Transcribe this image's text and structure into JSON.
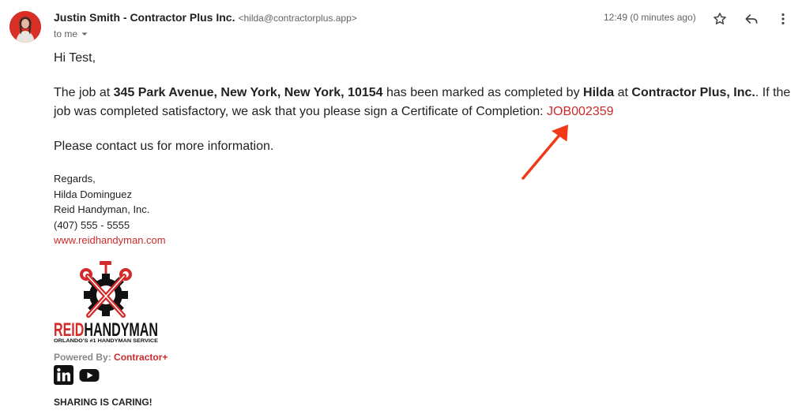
{
  "header": {
    "sender_name": "Justin Smith - Contractor Plus Inc.",
    "sender_email": "<hilda@contractorplus.app>",
    "to_label": "to me",
    "timestamp": "12:49 (0 minutes ago)"
  },
  "body": {
    "greeting": "Hi Test,",
    "p1_a": "The job at ",
    "address": "345 Park Avenue, New York, New York, 10154",
    "p1_b": " has been marked as completed by ",
    "worker": "Hilda",
    "p1_c": " at ",
    "company": "Contractor Plus, Inc.",
    "p1_d": ". If the job was completed satisfactory, we ask that you please sign a Certificate of Completion: ",
    "job_link": "JOB002359",
    "p2": "Please contact us for more information."
  },
  "signature": {
    "regards": "Regards,",
    "name": "Hilda Dominguez",
    "company": "Reid Handyman, Inc.",
    "phone": "(407) 555 - 5555",
    "website": "www.reidhandyman.com"
  },
  "logo": {
    "name_red": "REID",
    "name_black": "HANDYMAN",
    "tagline": "ORLANDO'S #1 HANDYMAN SERVICE"
  },
  "footer": {
    "powered_label": "Powered By: ",
    "powered_brand": "Contractor+",
    "sharing": "SHARING IS CARING!"
  },
  "icons": {
    "star": "star-icon",
    "reply": "reply-icon",
    "more": "more-vert-icon",
    "dropdown": "chevron-down-icon",
    "linkedin": "linkedin-icon",
    "youtube": "youtube-icon"
  },
  "colors": {
    "accent_red": "#cc2929",
    "annotation_arrow": "#f03a17",
    "secondary_text": "#5f6368"
  }
}
